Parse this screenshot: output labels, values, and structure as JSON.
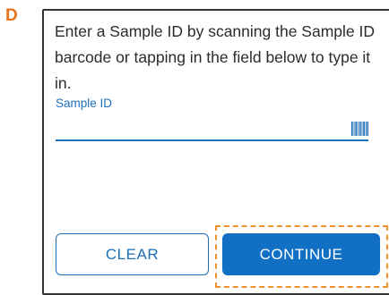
{
  "figure": {
    "panel_letter": "D"
  },
  "screen": {
    "instructions": "Enter a Sample ID by scanning the Sample ID barcode or tapping in the field below to type it in.",
    "sample_id_field": {
      "label": "Sample ID",
      "value": "",
      "icon": "barcode-icon"
    },
    "buttons": {
      "clear_label": "CLEAR",
      "continue_label": "CONTINUE"
    }
  },
  "colors": {
    "accent": "#1170c4",
    "label_blue": "#1f6fb8",
    "highlight": "#f0922c",
    "panel_letter": "#e8731a"
  }
}
